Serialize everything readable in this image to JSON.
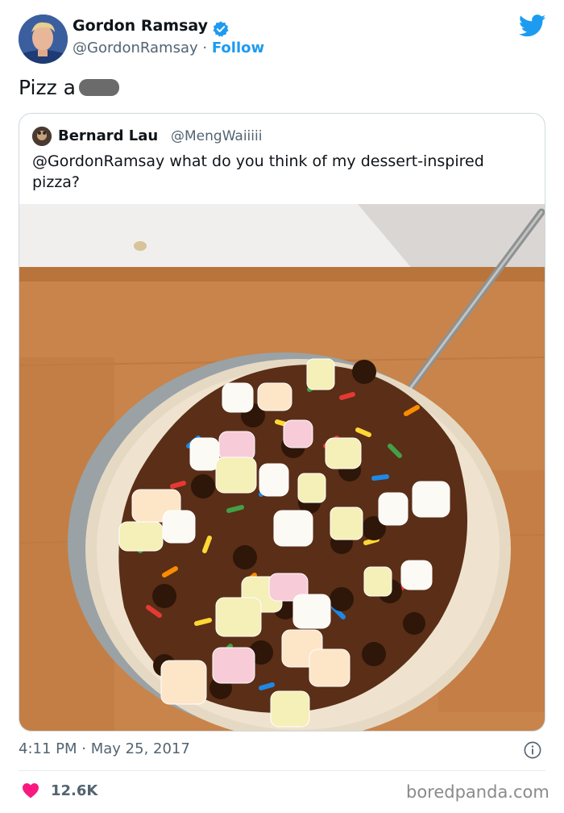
{
  "author": {
    "name": "Gordon Ramsay",
    "handle": "@GordonRamsay",
    "separator": "·",
    "follow_label": "Follow",
    "verified": true
  },
  "tweet": {
    "text": "Pizz a"
  },
  "quoted_tweet": {
    "name": "Bernard Lau",
    "handle": "@MengWaiiiii",
    "text": "@GordonRamsay what do you think of my dessert-inspired pizza?",
    "image_description": "tortilla pizza topped with chocolate spread, marshmallows, chocolate chips and rainbow sprinkles on a wooden board"
  },
  "meta": {
    "time": "4:11 PM",
    "separator": "·",
    "date": "May 25, 2017",
    "likes": "12.6K"
  },
  "watermark": "boredpanda.com",
  "icons": [
    "verified-badge-icon",
    "twitter-bird-icon",
    "info-icon",
    "heart-icon"
  ],
  "colors": {
    "accent": "#1d9bf0",
    "heart": "#f91880",
    "text_primary": "#0f1419",
    "text_secondary": "#536471",
    "border": "#cfd9de"
  }
}
